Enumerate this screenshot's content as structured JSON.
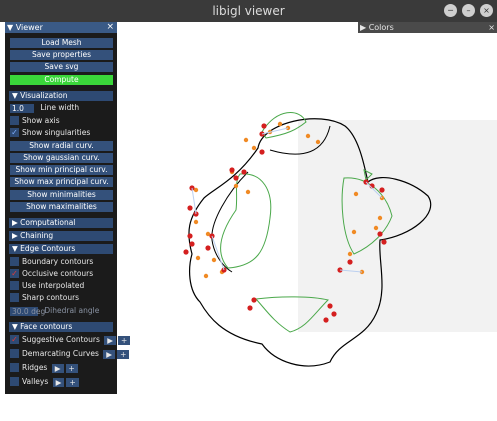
{
  "window": {
    "title": "libigl viewer",
    "controls": [
      "─",
      "–",
      "×"
    ]
  },
  "colors_panel": {
    "label": "▶ Colors",
    "close": "×"
  },
  "viewer_panel": {
    "title": "▼ Viewer",
    "close": "×",
    "buttons": {
      "load_mesh": "Load Mesh",
      "save_properties": "Save properties",
      "save_svg": "Save svg",
      "compute": "Compute"
    },
    "visualization": {
      "header": "▼ Visualization",
      "line_width_value": "1.0",
      "line_width_label": "Line width",
      "show_axis": "Show axis",
      "show_singularities": "Show singularities",
      "buttons": [
        "Show radial curv.",
        "Show gaussian curv.",
        "Show min principal curv.",
        "Show max principal curv.",
        "Show minimalities",
        "Show maximalities"
      ]
    },
    "computational": "▶ Computational",
    "chaining": "▶ Chaining",
    "edge_contours": {
      "header": "▼ Edge Contours",
      "boundary": "Boundary contours",
      "occlusive": "Occlusive contours",
      "interpolated": "Use interpolated",
      "sharp": "Sharp contours",
      "dihedral_value": "30.0 deg",
      "dihedral_label": "Dihedral angle"
    },
    "face_contours": {
      "header": "▼ Face contours",
      "suggestive": "Suggestive Contours",
      "demarcating": "Demarcating Curves",
      "ridges": "Ridges",
      "valleys": "Valleys",
      "arrow": "▶",
      "plus": "+"
    }
  },
  "glyphs": {
    "check": "✓"
  },
  "accent_colors": {
    "panel_header": "#3a5a86",
    "button": "#34517b",
    "compute": "#3ad63a",
    "contour": "#000000",
    "suggestive": "#4aa84a",
    "points": "#f08a24",
    "singularity": "#d41f1f"
  }
}
